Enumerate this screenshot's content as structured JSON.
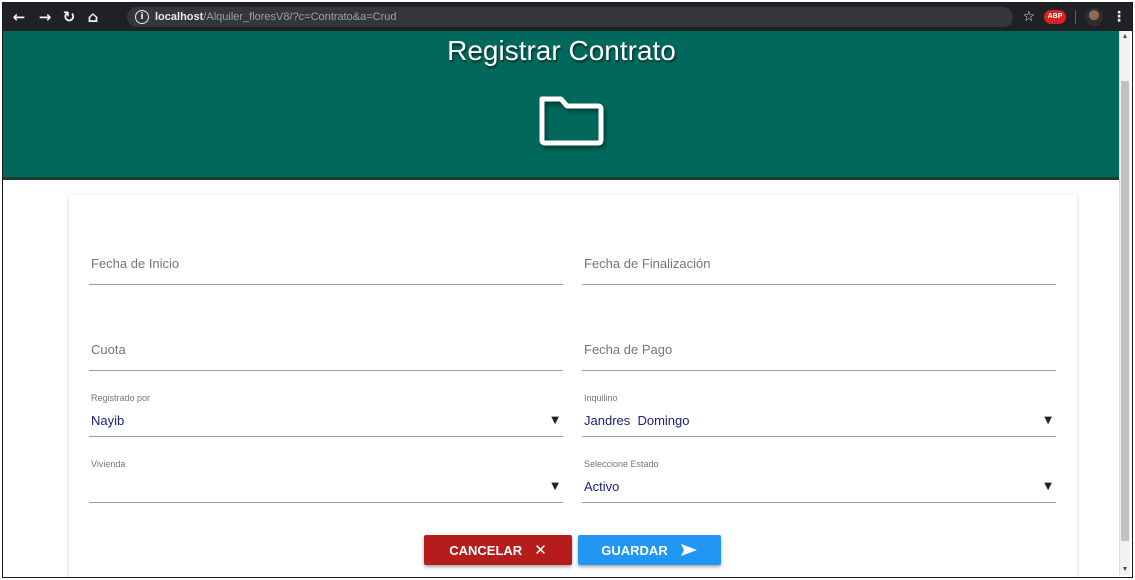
{
  "browser": {
    "url_host": "localhost",
    "url_path": "/Alquiler_floresV8/?c=Contrato&a=Crud",
    "extension_label": "ABP"
  },
  "header": {
    "title": "Registrar Contrato",
    "icon": "folder-icon",
    "background_color": "#00695c"
  },
  "form": {
    "fecha_inicio": {
      "placeholder": "Fecha de Inicio"
    },
    "fecha_finalizacion": {
      "placeholder": "Fecha de Finalización"
    },
    "cuota": {
      "placeholder": "Cuota"
    },
    "fecha_pago": {
      "placeholder": "Fecha de Pago"
    },
    "registrado_por": {
      "label": "Registrado por",
      "value": "Nayib"
    },
    "inquilino": {
      "label": "Inquilino",
      "value": "Jandres  Domingo"
    },
    "vivienda": {
      "label": "Vivienda",
      "value": ""
    },
    "estado": {
      "label": "Seleccione Estado",
      "value": "Activo"
    }
  },
  "buttons": {
    "cancel": {
      "label": "CANCELAR",
      "icon": "close-icon",
      "color": "#b71c1c"
    },
    "save": {
      "label": "GUARDAR",
      "icon": "send-icon",
      "color": "#2196f3"
    }
  }
}
